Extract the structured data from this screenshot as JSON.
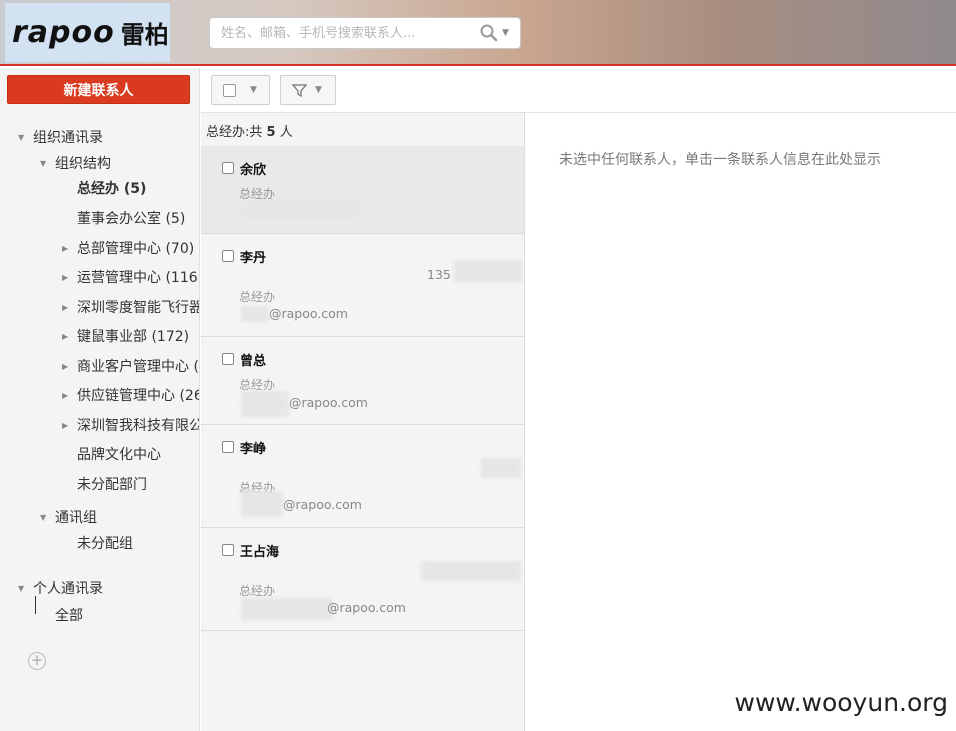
{
  "header": {
    "logo_text": "rapoo",
    "logo_cn": "雷柏",
    "search_placeholder": "姓名、邮箱、手机号搜索联系人..."
  },
  "sidebar": {
    "new_contact_label": "新建联系人",
    "org_root": "组织通讯录",
    "org_structure": "组织结构",
    "departments": [
      {
        "label": "总经办 (5)",
        "selected": true,
        "expandable": false
      },
      {
        "label": "董事会办公室 (5)",
        "selected": false,
        "expandable": false
      },
      {
        "label": "总部管理中心 (70)",
        "selected": false,
        "expandable": true
      },
      {
        "label": "运营管理中心 (116",
        "selected": false,
        "expandable": true
      },
      {
        "label": "深圳零度智能飞行器",
        "selected": false,
        "expandable": true
      },
      {
        "label": "键鼠事业部 (172)",
        "selected": false,
        "expandable": true
      },
      {
        "label": "商业客户管理中心 (",
        "selected": false,
        "expandable": true
      },
      {
        "label": "供应链管理中心 (26",
        "selected": false,
        "expandable": true
      },
      {
        "label": "深圳智我科技有限公",
        "selected": false,
        "expandable": true
      },
      {
        "label": "品牌文化中心",
        "selected": false,
        "expandable": false
      },
      {
        "label": "未分配部门",
        "selected": false,
        "expandable": false
      }
    ],
    "groups": "通讯组",
    "groups_unassigned": "未分配组",
    "personal_root": "个人通讯录",
    "personal_all": "全部"
  },
  "list": {
    "count_prefix": "总经办:共",
    "count_value": "5",
    "count_suffix": "人",
    "contacts": [
      {
        "name": "余欣",
        "dept": "总经办",
        "email": "",
        "phone": ""
      },
      {
        "name": "李丹",
        "dept": "总经办",
        "email": "@rapoo.com",
        "phone": "135"
      },
      {
        "name": "曾总",
        "dept": "总经办",
        "email": "@rapoo.com",
        "phone": ""
      },
      {
        "name": "李峥",
        "dept": "总经办",
        "email": "@rapoo.com",
        "phone": ""
      },
      {
        "name": "王占海",
        "dept": "总经办",
        "email": "@rapoo.com",
        "phone": ""
      }
    ]
  },
  "detail": {
    "hint": "未选中任何联系人，单击一条联系人信息在此处显示"
  },
  "watermark": "www.wooyun.org"
}
